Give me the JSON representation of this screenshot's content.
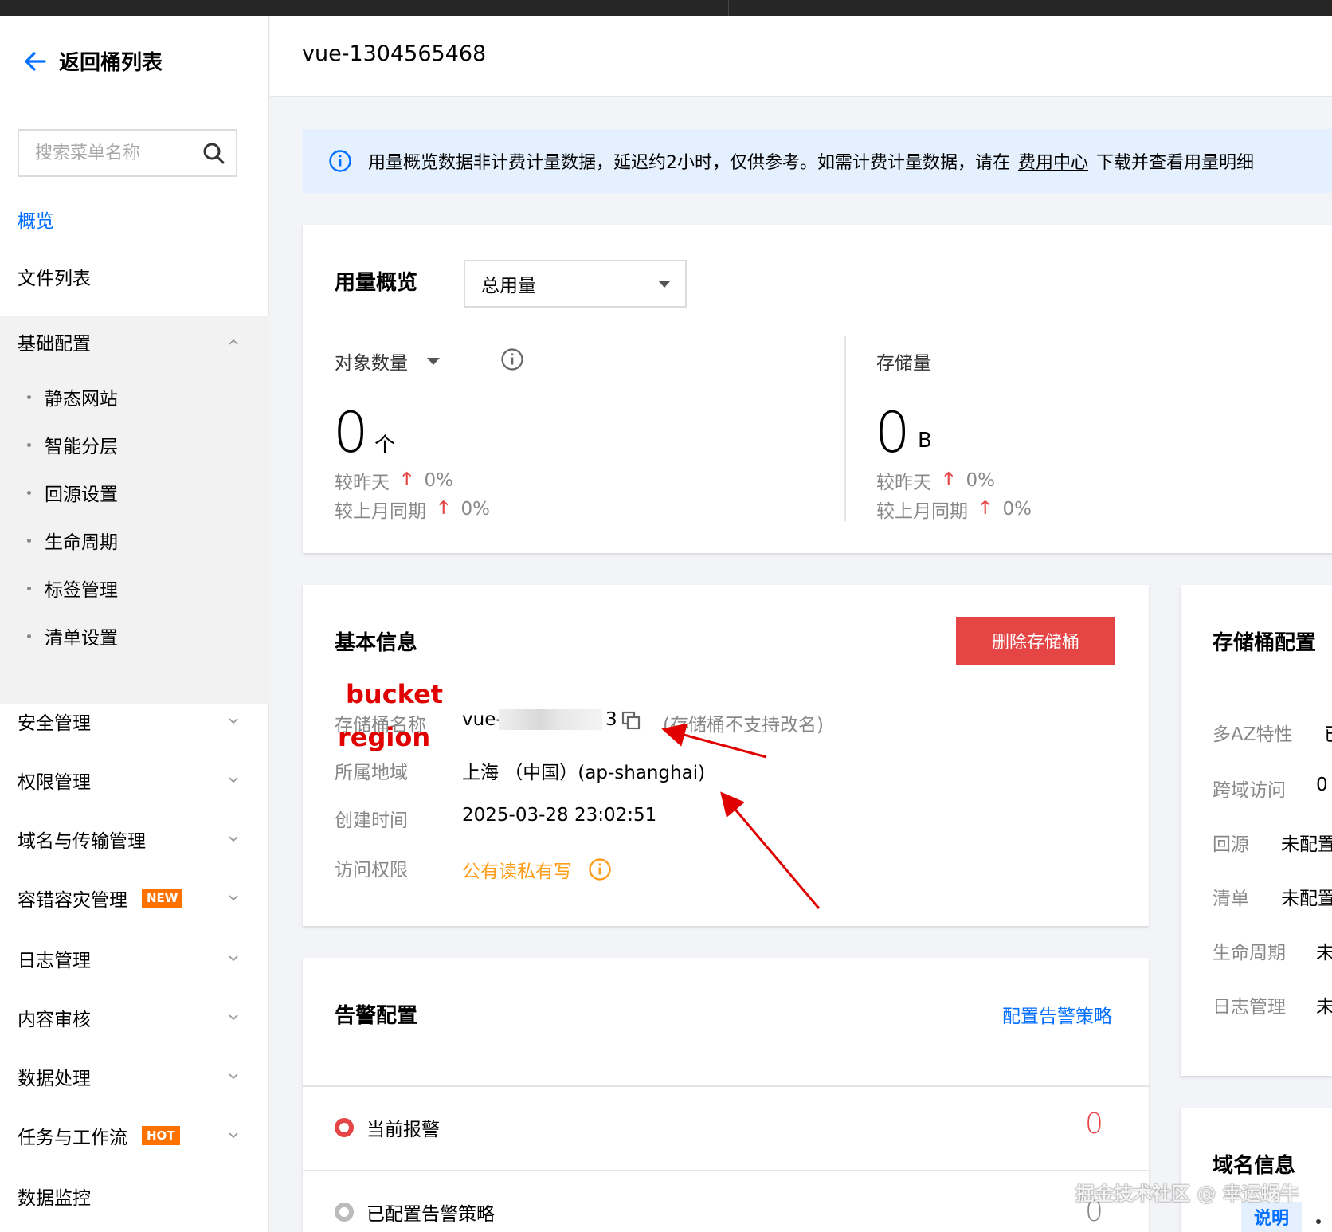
{
  "colors": {
    "accent": "#006eff",
    "danger": "#e54545",
    "warning": "#ff9c19",
    "badge": "#ff7200"
  },
  "sidebar": {
    "back_label": "返回桶列表",
    "search_placeholder": "搜索菜单名称",
    "items": [
      {
        "label": "概览"
      },
      {
        "label": "文件列表"
      },
      {
        "label": "基础配置"
      },
      {
        "label": "安全管理"
      },
      {
        "label": "权限管理"
      },
      {
        "label": "域名与传输管理"
      },
      {
        "label": "容错容灾管理",
        "badge": "NEW"
      },
      {
        "label": "日志管理"
      },
      {
        "label": "内容审核"
      },
      {
        "label": "数据处理"
      },
      {
        "label": "任务与工作流",
        "badge": "HOT"
      },
      {
        "label": "数据监控"
      }
    ],
    "sub_items": [
      "静态网站",
      "智能分层",
      "回源设置",
      "生命周期",
      "标签管理",
      "清单设置"
    ]
  },
  "header": {
    "title": "vue-1304565468"
  },
  "notice": {
    "text": "用量概览数据非计费计量数据，延迟约2小时，仅供参考。如需计费计量数据，请在",
    "link": "费用中心",
    "suffix": "下载并查看用量明细"
  },
  "usage": {
    "title": "用量概览",
    "select_value": "总用量",
    "objects": {
      "label": "对象数量",
      "value": "0",
      "unit": "个",
      "day_label": "较昨天",
      "day_value": "0%",
      "month_label": "较上月同期",
      "month_value": "0%"
    },
    "storage": {
      "label": "存储量",
      "value": "0",
      "unit": "B",
      "day_label": "较昨天",
      "day_value": "0%",
      "month_label": "较上月同期",
      "month_value": "0%"
    }
  },
  "basic": {
    "title": "基本信息",
    "delete_label": "删除存储桶",
    "annot_bucket": "bucket",
    "annot_region": "region",
    "rows": {
      "name_label": "存储桶名称",
      "name_prefix": "vue-",
      "name_suffix": "3",
      "name_note": "(存储桶不支持改名)",
      "region_label": "所属地域",
      "region_value": "上海 （中国）(ap-shanghai)",
      "created_label": "创建时间",
      "created_value": "2025-03-28 23:02:51",
      "access_label": "访问权限",
      "access_value": "公有读私有写"
    }
  },
  "alarm": {
    "title": "告警配置",
    "link": "配置告警策略",
    "current_label": "当前报警",
    "current_count": "0",
    "configured_label": "已配置告警策略",
    "configured_count": "0"
  },
  "bucket_config": {
    "title": "存储桶配置",
    "rows": [
      {
        "label": "多AZ特性",
        "value": "已"
      },
      {
        "label": "跨域访问",
        "value": "0"
      },
      {
        "label": "回源",
        "value": "未配置"
      },
      {
        "label": "清单",
        "value": "未配置"
      },
      {
        "label": "生命周期",
        "value": "未"
      },
      {
        "label": "日志管理",
        "value": "未"
      }
    ]
  },
  "domain_info": {
    "title": "域名信息",
    "explain": "说明"
  },
  "watermark": "掘金技术社区 @ 幸运蜗牛"
}
